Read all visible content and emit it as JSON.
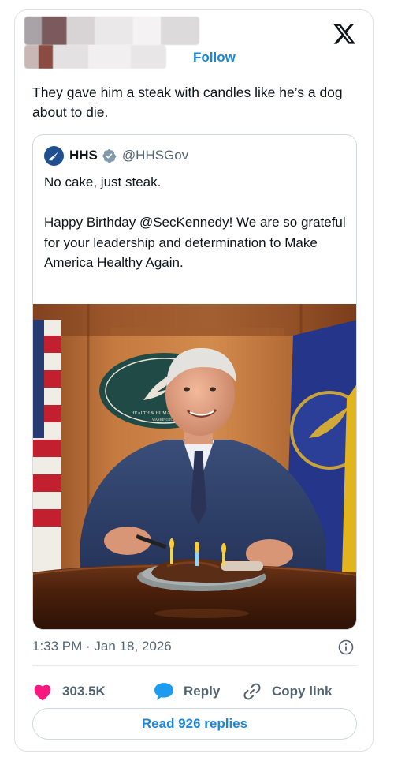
{
  "header": {
    "follow_label": "Follow",
    "logo_icon": "x-logo-icon"
  },
  "tweet": {
    "text": "They gave him a steak with candles like he’s a dog about to die."
  },
  "quoted_tweet": {
    "name": "HHS",
    "handle": "@HHSGov",
    "verified_icon": "verified-badge-icon",
    "text": "No cake, just steak.\n\nHappy Birthday @SecKennedy! We are so grateful for your leadership and determination to Make America Healthy Again.",
    "photo_sign_text": "HEALTH & HUMAN SERVICES",
    "photo_sign_subtext": "WASHINGTON"
  },
  "meta": {
    "timestamp": "1:33 PM · Jan 18, 2026",
    "info_icon": "info-icon"
  },
  "actions": {
    "like_count": "303.5K",
    "reply_label": "Reply",
    "copy_link_label": "Copy link"
  },
  "read_replies_label": "Read 926 replies",
  "colors": {
    "accent": "#1d86d6",
    "like": "#f91880",
    "reply_icon": "#1d9bf0",
    "text": "#0f1419",
    "muted": "#536471"
  }
}
